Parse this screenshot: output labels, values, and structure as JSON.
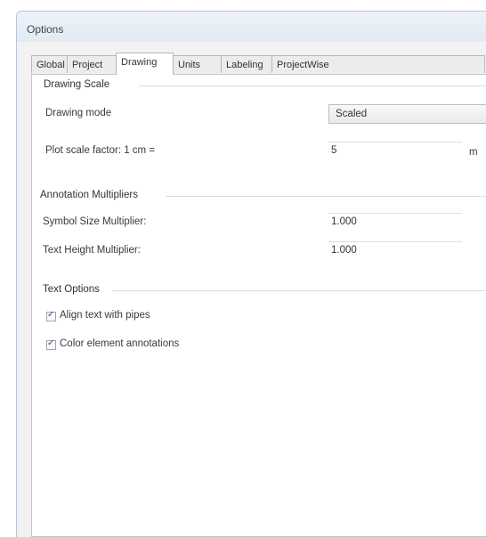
{
  "window": {
    "title": "Options"
  },
  "tabs": [
    {
      "label": "Global"
    },
    {
      "label": "Project"
    },
    {
      "label": "Drawing"
    },
    {
      "label": "Units"
    },
    {
      "label": "Labeling"
    },
    {
      "label": "ProjectWise"
    }
  ],
  "drawing_scale": {
    "section_label": "Drawing Scale",
    "mode_label": "Drawing mode",
    "mode_value": "Scaled",
    "plot_factor_label": "Plot scale factor: 1 cm =",
    "plot_factor_value": "5",
    "plot_factor_unit": "m"
  },
  "annotation_multipliers": {
    "section_label": "Annotation Multipliers",
    "symbol_size_label": "Symbol Size Multiplier:",
    "symbol_size_value": "1.000",
    "text_height_label": "Text Height Multiplier:",
    "text_height_value": "1.000"
  },
  "text_options": {
    "section_label": "Text Options",
    "align_label": "Align text with pipes",
    "align_checked": true,
    "color_label": "Color element annotations",
    "color_checked": true
  },
  "check_glyph": "✓"
}
